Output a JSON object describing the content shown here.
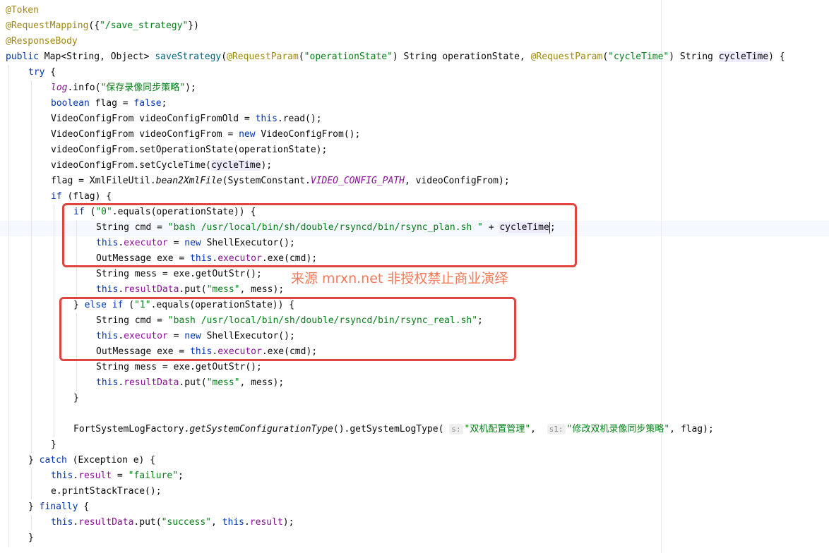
{
  "lines": [
    {
      "parts": [
        {
          "t": "@Token",
          "c": "ann"
        }
      ]
    },
    {
      "parts": [
        {
          "t": "@RequestMapping",
          "c": "ann"
        },
        {
          "t": "({"
        },
        {
          "t": "\"/save_strategy\"",
          "c": "str"
        },
        {
          "t": "})"
        }
      ]
    },
    {
      "parts": [
        {
          "t": "@ResponseBody",
          "c": "ann"
        }
      ]
    },
    {
      "parts": [
        {
          "t": "public ",
          "c": "kw"
        },
        {
          "t": "Map<String, Object> "
        },
        {
          "t": "saveStrategy",
          "c": "meth"
        },
        {
          "t": "("
        },
        {
          "t": "@RequestParam",
          "c": "ann"
        },
        {
          "t": "("
        },
        {
          "t": "\"operationState\"",
          "c": "str"
        },
        {
          "t": ") String operationState, "
        },
        {
          "t": "@RequestParam",
          "c": "ann"
        },
        {
          "t": "("
        },
        {
          "t": "\"cycleTime\"",
          "c": "str"
        },
        {
          "t": ") String "
        },
        {
          "t": "cycleTime",
          "c": "hl"
        },
        {
          "t": ") {"
        }
      ]
    },
    {
      "indent": 1,
      "parts": [
        {
          "t": "try",
          "c": "kw"
        },
        {
          "t": " {"
        }
      ]
    },
    {
      "indent": 2,
      "parts": [
        {
          "t": "log",
          "c": "fld ital"
        },
        {
          "t": ".info("
        },
        {
          "t": "\"保存录像同步策略\"",
          "c": "str"
        },
        {
          "t": ");"
        }
      ]
    },
    {
      "indent": 2,
      "parts": [
        {
          "t": "boolean ",
          "c": "kw"
        },
        {
          "t": "flag = "
        },
        {
          "t": "false",
          "c": "kw"
        },
        {
          "t": ";"
        }
      ]
    },
    {
      "indent": 2,
      "parts": [
        {
          "t": "VideoConfigFrom videoConfigFromOld = "
        },
        {
          "t": "this",
          "c": "kw"
        },
        {
          "t": ".read();"
        }
      ]
    },
    {
      "indent": 2,
      "parts": [
        {
          "t": "VideoConfigFrom videoConfigFrom = "
        },
        {
          "t": "new ",
          "c": "kw"
        },
        {
          "t": "VideoConfigFrom();"
        }
      ]
    },
    {
      "indent": 2,
      "parts": [
        {
          "t": "videoConfigFrom.setOperationState(operationState);"
        }
      ]
    },
    {
      "indent": 2,
      "parts": [
        {
          "t": "videoConfigFrom.setCycleTime("
        },
        {
          "t": "cycleTime",
          "c": "hl"
        },
        {
          "t": ");"
        }
      ]
    },
    {
      "indent": 2,
      "parts": [
        {
          "t": "flag = XmlFileUtil."
        },
        {
          "t": "bean2XmlFile",
          "c": "ital"
        },
        {
          "t": "(SystemConstant."
        },
        {
          "t": "VIDEO_CONFIG_PATH",
          "c": "const"
        },
        {
          "t": ", videoConfigFrom);"
        }
      ]
    },
    {
      "indent": 2,
      "parts": [
        {
          "t": "if",
          "c": "kw"
        },
        {
          "t": " (flag) {"
        }
      ]
    },
    {
      "indent": 3,
      "parts": [
        {
          "t": "if",
          "c": "kw"
        },
        {
          "t": " ("
        },
        {
          "t": "\"0\"",
          "c": "str"
        },
        {
          "t": ".equals(operationState)) {"
        }
      ]
    },
    {
      "indent": 4,
      "parts": [
        {
          "t": "String cmd = "
        },
        {
          "t": "\"bash /usr/local/bin/sh/double/rsyncd/bin/rsync_plan.sh \"",
          "c": "str"
        },
        {
          "t": " + "
        },
        {
          "t": "cycleTime",
          "c": "hl"
        },
        {
          "t": "",
          "c": "caret"
        },
        {
          "t": ";"
        }
      ]
    },
    {
      "indent": 4,
      "parts": [
        {
          "t": "this",
          "c": "kw"
        },
        {
          "t": "."
        },
        {
          "t": "executor",
          "c": "fld"
        },
        {
          "t": " = "
        },
        {
          "t": "new ",
          "c": "kw"
        },
        {
          "t": "ShellExecutor();"
        }
      ]
    },
    {
      "indent": 4,
      "parts": [
        {
          "t": "OutMessage exe = "
        },
        {
          "t": "this",
          "c": "kw"
        },
        {
          "t": "."
        },
        {
          "t": "executor",
          "c": "fld"
        },
        {
          "t": ".exe(cmd);"
        }
      ]
    },
    {
      "indent": 4,
      "parts": [
        {
          "t": "String mess = exe.getOutStr();"
        }
      ]
    },
    {
      "indent": 4,
      "parts": [
        {
          "t": "this",
          "c": "kw"
        },
        {
          "t": "."
        },
        {
          "t": "resultData",
          "c": "fld"
        },
        {
          "t": ".put("
        },
        {
          "t": "\"mess\"",
          "c": "str"
        },
        {
          "t": ", mess);"
        }
      ]
    },
    {
      "indent": 3,
      "parts": [
        {
          "t": "} "
        },
        {
          "t": "else if",
          "c": "kw"
        },
        {
          "t": " ("
        },
        {
          "t": "\"1\"",
          "c": "str"
        },
        {
          "t": ".equals(operationState)) {"
        }
      ]
    },
    {
      "indent": 4,
      "parts": [
        {
          "t": "String cmd = "
        },
        {
          "t": "\"bash /usr/local/bin/sh/double/rsyncd/bin/rsync_real.sh\"",
          "c": "str"
        },
        {
          "t": ";"
        }
      ]
    },
    {
      "indent": 4,
      "parts": [
        {
          "t": "this",
          "c": "kw"
        },
        {
          "t": "."
        },
        {
          "t": "executor",
          "c": "fld"
        },
        {
          "t": " = "
        },
        {
          "t": "new ",
          "c": "kw"
        },
        {
          "t": "ShellExecutor();"
        }
      ]
    },
    {
      "indent": 4,
      "parts": [
        {
          "t": "OutMessage exe = "
        },
        {
          "t": "this",
          "c": "kw"
        },
        {
          "t": "."
        },
        {
          "t": "executor",
          "c": "fld"
        },
        {
          "t": ".exe(cmd);"
        }
      ]
    },
    {
      "indent": 4,
      "parts": [
        {
          "t": "String mess = exe.getOutStr();"
        }
      ]
    },
    {
      "indent": 4,
      "parts": [
        {
          "t": "this",
          "c": "kw"
        },
        {
          "t": "."
        },
        {
          "t": "resultData",
          "c": "fld"
        },
        {
          "t": ".put("
        },
        {
          "t": "\"mess\"",
          "c": "str"
        },
        {
          "t": ", mess);"
        }
      ]
    },
    {
      "indent": 3,
      "parts": [
        {
          "t": "}"
        }
      ]
    },
    {
      "parts": []
    },
    {
      "indent": 3,
      "parts": [
        {
          "t": "FortSystemLogFactory."
        },
        {
          "t": "getSystemConfigurationType",
          "c": "ital"
        },
        {
          "t": "().getSystemLogType( "
        },
        {
          "t": "s:",
          "c": "hint"
        },
        {
          "t": "\"双机配置管理\"",
          "c": "str"
        },
        {
          "t": ",  "
        },
        {
          "t": "s1:",
          "c": "hint"
        },
        {
          "t": "\"修改双机录像同步策略\"",
          "c": "str"
        },
        {
          "t": ", flag);"
        }
      ]
    },
    {
      "indent": 2,
      "parts": [
        {
          "t": "}"
        }
      ]
    },
    {
      "indent": 1,
      "parts": [
        {
          "t": "} "
        },
        {
          "t": "catch",
          "c": "kw"
        },
        {
          "t": " (Exception e) {"
        }
      ]
    },
    {
      "indent": 2,
      "parts": [
        {
          "t": "this",
          "c": "kw"
        },
        {
          "t": "."
        },
        {
          "t": "result",
          "c": "fld"
        },
        {
          "t": " = "
        },
        {
          "t": "\"failure\"",
          "c": "str"
        },
        {
          "t": ";"
        }
      ]
    },
    {
      "indent": 2,
      "parts": [
        {
          "t": "e.printStackTrace();"
        }
      ]
    },
    {
      "indent": 1,
      "parts": [
        {
          "t": "} "
        },
        {
          "t": "finally",
          "c": "kw"
        },
        {
          "t": " {"
        }
      ]
    },
    {
      "indent": 2,
      "parts": [
        {
          "t": "this",
          "c": "kw"
        },
        {
          "t": "."
        },
        {
          "t": "resultData",
          "c": "fld"
        },
        {
          "t": ".put("
        },
        {
          "t": "\"success\"",
          "c": "str"
        },
        {
          "t": ", "
        },
        {
          "t": "this",
          "c": "kw"
        },
        {
          "t": "."
        },
        {
          "t": "result",
          "c": "fld"
        },
        {
          "t": ");"
        }
      ]
    },
    {
      "indent": 1,
      "parts": [
        {
          "t": "}"
        }
      ]
    }
  ],
  "watermark": "来源 mrxn.net 非授权禁止商业演绎",
  "colors": {
    "annotation": "#9e880d",
    "keyword": "#0033b3",
    "string": "#067d17",
    "field": "#871094",
    "method": "#00627a",
    "box": "#e0453f",
    "watermark": "#f07a5a"
  }
}
